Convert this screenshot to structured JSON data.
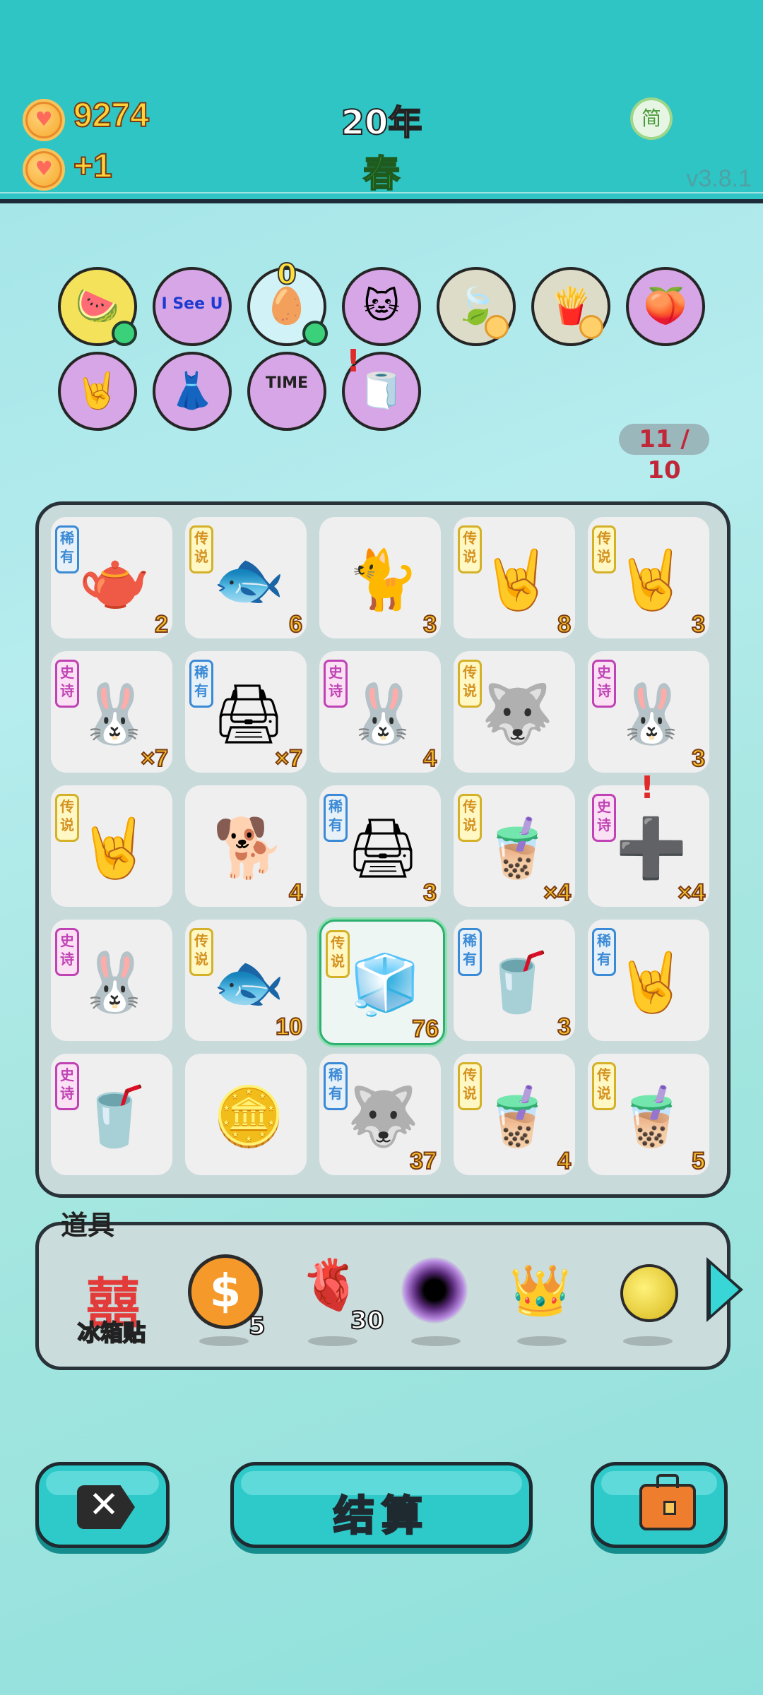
{
  "header": {
    "coins": "9274",
    "income": "+1",
    "year": "20年",
    "season": "春",
    "language_button": "简",
    "version": "v3.8.1"
  },
  "relics": [
    {
      "name": "fruit-basket-icon",
      "glyph": "🍉"
    },
    {
      "name": "i-see-u-sign-icon",
      "glyph": "I See U"
    },
    {
      "name": "egg-tray-icon",
      "glyph": "🥚",
      "badge": "0"
    },
    {
      "name": "cool-cat-icon",
      "glyph": "🐱"
    },
    {
      "name": "leaf-icon",
      "glyph": "🍃"
    },
    {
      "name": "french-fries-icon",
      "glyph": "🍟"
    },
    {
      "name": "peach-chopsticks-icon",
      "glyph": "🍑"
    },
    {
      "name": "rock-hand-icon",
      "glyph": "🤘"
    },
    {
      "name": "pleated-skirt-icon",
      "glyph": "👗"
    },
    {
      "name": "time-magazine-icon",
      "glyph": "TIME"
    },
    {
      "name": "tissue-box-icon",
      "glyph": "🧻"
    }
  ],
  "relic_counter": "11 / 10",
  "board": [
    {
      "tag": "稀有",
      "rarity": "rare",
      "icon": "teapot-icon",
      "glyph": "🫖",
      "qty": "2"
    },
    {
      "tag": "传说",
      "rarity": "leg",
      "icon": "koi-fish-icon",
      "glyph": "🐟",
      "qty": "6"
    },
    {
      "tag": "",
      "rarity": "",
      "icon": "yellow-cat-icon",
      "glyph": "🐈",
      "qty": "3"
    },
    {
      "tag": "传说",
      "rarity": "leg",
      "icon": "rainbow-rock-hand-icon",
      "glyph": "🤘",
      "qty": "8"
    },
    {
      "tag": "传说",
      "rarity": "leg",
      "icon": "rock-hand-icon",
      "glyph": "🤘",
      "qty": "3"
    },
    {
      "tag": "史诗",
      "rarity": "epic",
      "icon": "rabbit-house-icon",
      "glyph": "🐰",
      "qty": "×7"
    },
    {
      "tag": "稀有",
      "rarity": "rare",
      "icon": "printer-icon",
      "glyph": "🖨",
      "qty": "×7"
    },
    {
      "tag": "史诗",
      "rarity": "epic",
      "icon": "rabbit-house-icon",
      "glyph": "🐰",
      "qty": "4"
    },
    {
      "tag": "传说",
      "rarity": "leg",
      "icon": "crowned-husky-icon",
      "glyph": "🐺",
      "qty": ""
    },
    {
      "tag": "史诗",
      "rarity": "epic",
      "icon": "rabbit-house-icon",
      "glyph": "🐰",
      "qty": "3"
    },
    {
      "tag": "传说",
      "rarity": "leg",
      "icon": "rock-hand-icon",
      "glyph": "🤘",
      "qty": ""
    },
    {
      "tag": "",
      "rarity": "",
      "icon": "brown-dog-icon",
      "glyph": "🐕",
      "qty": "4"
    },
    {
      "tag": "稀有",
      "rarity": "rare",
      "icon": "printer-icon",
      "glyph": "🖨",
      "qty": "3"
    },
    {
      "tag": "传说",
      "rarity": "leg",
      "icon": "boba-cup-icon",
      "glyph": "🧋",
      "qty": "×4"
    },
    {
      "tag": "史诗",
      "rarity": "epic",
      "icon": "ctrl-c-ctrl-v-icon",
      "glyph": "➕",
      "qty": "×4"
    },
    {
      "tag": "史诗",
      "rarity": "epic",
      "icon": "rabbit-house-icon",
      "glyph": "🐰",
      "qty": ""
    },
    {
      "tag": "传说",
      "rarity": "leg",
      "icon": "koi-fish-icon",
      "glyph": "🐟",
      "qty": "10"
    },
    {
      "tag": "传说",
      "rarity": "leg",
      "icon": "fridge-icon",
      "glyph": "🧊",
      "qty": "76"
    },
    {
      "tag": "稀有",
      "rarity": "rare",
      "icon": "milk-tea-icon",
      "glyph": "🥤",
      "qty": "3"
    },
    {
      "tag": "稀有",
      "rarity": "rare",
      "icon": "brown-rock-hand-icon",
      "glyph": "🤘",
      "qty": ""
    },
    {
      "tag": "史诗",
      "rarity": "epic",
      "icon": "boba-tea-icon",
      "glyph": "🥤",
      "qty": ""
    },
    {
      "tag": "",
      "rarity": "",
      "icon": "coin-burst-icon",
      "glyph": "🪙",
      "qty": ""
    },
    {
      "tag": "稀有",
      "rarity": "rare",
      "icon": "husky-icon",
      "glyph": "🐺",
      "qty": "37"
    },
    {
      "tag": "传说",
      "rarity": "leg",
      "icon": "boba-cup-icon",
      "glyph": "🧋",
      "qty": "4"
    },
    {
      "tag": "传说",
      "rarity": "leg",
      "icon": "boba-cup-icon",
      "glyph": "🧋",
      "qty": "5"
    }
  ],
  "tools": {
    "label": "道具",
    "fridge_sticker_label": "冰箱贴",
    "fridge_sticker_glyph": "囍",
    "coin_count": "5",
    "liver_count": "30"
  },
  "buttons": {
    "settle": "结算"
  }
}
